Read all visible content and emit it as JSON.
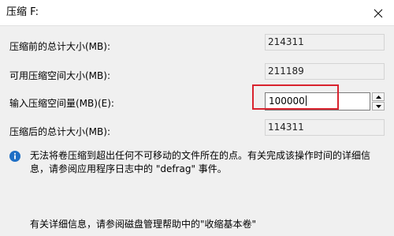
{
  "window": {
    "title": "压缩 F:"
  },
  "rows": [
    {
      "label": "压缩前的总计大小(MB):",
      "value": "214311"
    },
    {
      "label": "可用压缩空间大小(MB):",
      "value": "211189"
    },
    {
      "label": "输入压缩空间量(MB)(E):",
      "value": "100000"
    },
    {
      "label": "压缩后的总计大小(MB):",
      "value": "114311"
    }
  ],
  "info": {
    "icon": "info-icon",
    "text": "无法将卷压缩到超出任何不可移动的文件所在的点。有关完成该操作时间的详细信息，请参阅应用程序日志中的 \"defrag\" 事件。"
  },
  "footer": {
    "text": "有关详细信息，请参阅磁盘管理帮助中的\"收缩基本卷\""
  },
  "colors": {
    "highlight": "#d9232e",
    "info_blue": "#1f6fc5",
    "background": "#f0f0f0"
  }
}
